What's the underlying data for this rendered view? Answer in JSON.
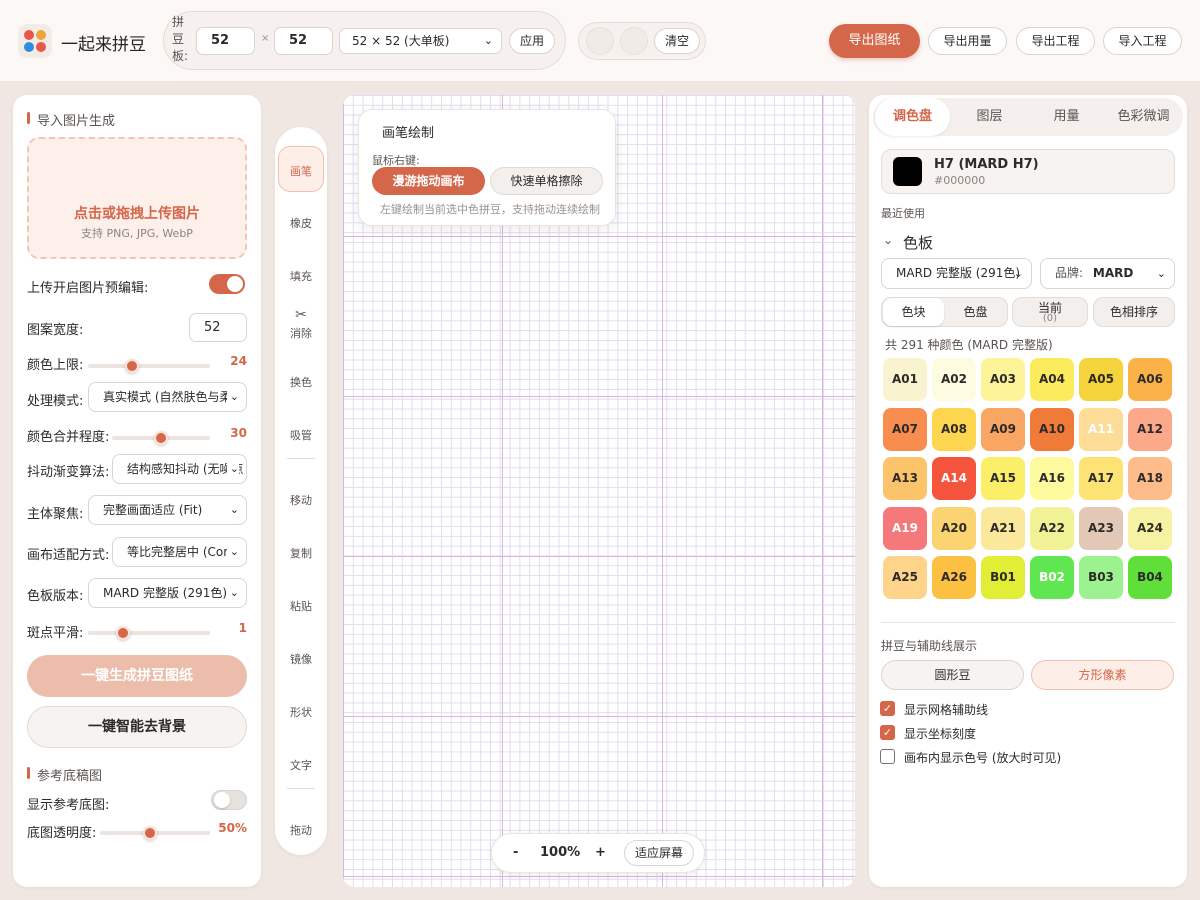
{
  "app": {
    "title": "一起来拼豆"
  },
  "header": {
    "board_label": "拼豆板:",
    "width": "52",
    "times": "×",
    "height": "52",
    "size_select": "52 × 52 (大单板)",
    "apply": "应用",
    "clear": "清空",
    "export_pattern": "导出图纸",
    "export_usage": "导出用量",
    "export_project": "导出工程",
    "import_project": "导入工程"
  },
  "left": {
    "import_title": "导入图片生成",
    "upload_main": "点击或拖拽上传图片",
    "upload_sub": "支持 PNG, JPG, WebP",
    "preedit_label": "上传开启图片预编辑:",
    "preedit_on": true,
    "width_label": "图案宽度:",
    "width_value": "52",
    "color_limit_label": "颜色上限:",
    "color_limit_value": "24",
    "mode_label": "处理模式:",
    "mode_value": "真实模式 (自然肤色与柔",
    "merge_label": "颜色合并程度:",
    "merge_value": "30",
    "dither_label": "抖动渐变算法:",
    "dither_value": "结构感知抖动 (无噪点",
    "focus_label": "主体聚焦:",
    "focus_value": "完整画面适应 (Fit)",
    "fit_label": "画布适配方式:",
    "fit_value": "等比完整居中 (Con",
    "palette_label": "色板版本:",
    "palette_value": "MARD 完整版 (291色)",
    "smooth_label": "斑点平滑:",
    "smooth_value": "1",
    "generate_btn": "一键生成拼豆图纸",
    "remove_bg_btn": "一键智能去背景",
    "ref_title": "参考底稿图",
    "show_ref_label": "显示参考底图:",
    "show_ref_on": false,
    "opacity_label": "底图透明度:",
    "opacity_value": "50%",
    "sliders": {
      "color_limit": 0.36,
      "merge": 0.5,
      "smooth": 0.29,
      "opacity": 0.45
    }
  },
  "tools": [
    {
      "label": "画笔",
      "icon": "",
      "active": true
    },
    {
      "label": "橡皮",
      "icon": ""
    },
    {
      "label": "填充",
      "icon": ""
    },
    {
      "label": "消除",
      "icon": "✂"
    },
    {
      "label": "换色",
      "icon": ""
    },
    {
      "label": "吸管",
      "icon": ""
    },
    {
      "label": "移动",
      "icon": ""
    },
    {
      "label": "复制",
      "icon": ""
    },
    {
      "label": "粘贴",
      "icon": ""
    },
    {
      "label": "镜像",
      "icon": ""
    },
    {
      "label": "形状",
      "icon": ""
    },
    {
      "label": "文字",
      "icon": ""
    },
    {
      "label": "拖动",
      "icon": ""
    }
  ],
  "brush_popup": {
    "title": "画笔绘制",
    "right_click_label": "鼠标右键:",
    "pan_btn": "漫游拖动画布",
    "erase_btn": "快速单格擦除",
    "hint": "左键绘制当前选中色拼豆，支持拖动连续绘制"
  },
  "zoom": {
    "minus": "-",
    "level": "100%",
    "plus": "+",
    "fit": "适应屏幕"
  },
  "right": {
    "tabs": [
      "调色盘",
      "图层",
      "用量",
      "色彩微调"
    ],
    "current_name": "H7 (MARD H7)",
    "current_hex": "#000000",
    "recent_label": "最近使用",
    "palette_title": "色板",
    "palette_select": "MARD 完整版 (291色)",
    "brand_label": "品牌:",
    "brand_value": "MARD",
    "view_tabs": [
      "色块",
      "色盘"
    ],
    "current_btn": "当前",
    "current_count": "(0)",
    "hue_sort": "色相排序",
    "count_text": "共 291 种颜色 (MARD 完整版)",
    "display_title": "拼豆与辅助线展示",
    "round_bead": "圆形豆",
    "square_pixel": "方形像素",
    "checks": [
      {
        "label": "显示网格辅助线",
        "on": true
      },
      {
        "label": "显示坐标刻度",
        "on": true
      },
      {
        "label": "画布内显示色号 (放大时可见)",
        "on": false
      }
    ]
  },
  "colors": {
    "accent": "#d4664a",
    "palette": [
      {
        "code": "A01",
        "hex": "#faf3d0",
        "text": "#2d2a28"
      },
      {
        "code": "A02",
        "hex": "#fdfbe0",
        "text": "#2d2a28"
      },
      {
        "code": "A03",
        "hex": "#fdf49a",
        "text": "#2d2a28"
      },
      {
        "code": "A04",
        "hex": "#fdeb5e",
        "text": "#2d2a28"
      },
      {
        "code": "A05",
        "hex": "#f4d33c",
        "text": "#2d2a28"
      },
      {
        "code": "A06",
        "hex": "#fbb349",
        "text": "#2d2a28"
      },
      {
        "code": "A07",
        "hex": "#f78e4f",
        "text": "#2d2a28"
      },
      {
        "code": "A08",
        "hex": "#fdd54f",
        "text": "#2d2a28"
      },
      {
        "code": "A09",
        "hex": "#f9a563",
        "text": "#2d2a28"
      },
      {
        "code": "A10",
        "hex": "#f07b39",
        "text": "#2d2a28"
      },
      {
        "code": "A11",
        "hex": "#fddc98",
        "text": "#ffffff"
      },
      {
        "code": "A12",
        "hex": "#fca88a",
        "text": "#2d2a28"
      },
      {
        "code": "A13",
        "hex": "#fcc46a",
        "text": "#2d2a28"
      },
      {
        "code": "A14",
        "hex": "#f4533c",
        "text": "#ffffff"
      },
      {
        "code": "A15",
        "hex": "#fbef69",
        "text": "#2d2a28"
      },
      {
        "code": "A16",
        "hex": "#fdfb9e",
        "text": "#2d2a28"
      },
      {
        "code": "A17",
        "hex": "#fde374",
        "text": "#2d2a28"
      },
      {
        "code": "A18",
        "hex": "#fdbc8a",
        "text": "#2d2a28"
      },
      {
        "code": "A19",
        "hex": "#f5787b",
        "text": "#ffffff"
      },
      {
        "code": "A20",
        "hex": "#fbd371",
        "text": "#2d2a28"
      },
      {
        "code": "A21",
        "hex": "#fce89a",
        "text": "#2d2a28"
      },
      {
        "code": "A22",
        "hex": "#f1f295",
        "text": "#2d2a28"
      },
      {
        "code": "A23",
        "hex": "#e3c8b8",
        "text": "#2d2a28"
      },
      {
        "code": "A24",
        "hex": "#f5f2a3",
        "text": "#2d2a28"
      },
      {
        "code": "A25",
        "hex": "#fdd48a",
        "text": "#2d2a28"
      },
      {
        "code": "A26",
        "hex": "#fcc042",
        "text": "#2d2a28"
      },
      {
        "code": "B01",
        "hex": "#e1ee35",
        "text": "#2d2a28"
      },
      {
        "code": "B02",
        "hex": "#5fe651",
        "text": "#ffffff"
      },
      {
        "code": "B03",
        "hex": "#9df290",
        "text": "#2d2a28"
      },
      {
        "code": "B04",
        "hex": "#60df3a",
        "text": "#2d2a28"
      }
    ],
    "peek_row": [
      "#3fbf6a",
      "#8fd9a0",
      "#2fa89a",
      "#2f5f5a",
      "#b5dfcf",
      "#6ec7b6"
    ]
  }
}
